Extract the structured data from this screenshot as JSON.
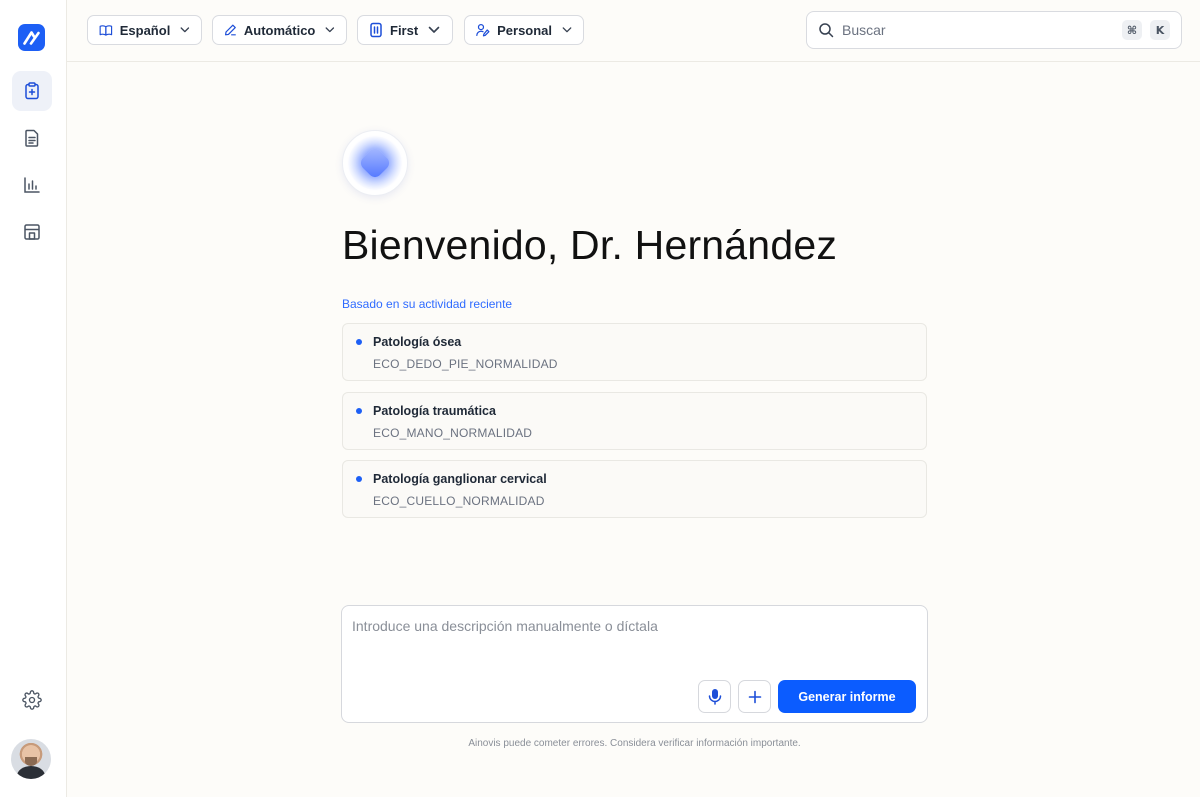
{
  "colors": {
    "accent": "#0b5cff",
    "link": "#2f6bff",
    "background": "#fdfcf9"
  },
  "sidebar": {
    "items": [
      {
        "name": "new-report",
        "icon": "clipboard-plus-icon",
        "active": true
      },
      {
        "name": "documents",
        "icon": "document-icon",
        "active": false
      },
      {
        "name": "statistics",
        "icon": "bar-chart-icon",
        "active": false
      },
      {
        "name": "templates",
        "icon": "layout-icon",
        "active": false
      }
    ],
    "settings_icon": "gear-icon"
  },
  "toolbar": {
    "language_label": "Español",
    "mode_label": "Automático",
    "template_label": "First",
    "profile_label": "Personal"
  },
  "search": {
    "placeholder": "Buscar",
    "shortcut_cmd": "⌘",
    "shortcut_key": "K"
  },
  "main": {
    "welcome": "Bienvenido, Dr. Hernández",
    "recent_label": "Basado en su actividad reciente",
    "recent": [
      {
        "title": "Patología ósea",
        "code": "ECO_DEDO_PIE_NORMALIDAD"
      },
      {
        "title": "Patología traumática",
        "code": "ECO_MANO_NORMALIDAD"
      },
      {
        "title": "Patología ganglionar cervical",
        "code": "ECO_CUELLO_NORMALIDAD"
      }
    ]
  },
  "composer": {
    "placeholder": "Introduce una descripción manualmente o díctala",
    "generate_label": "Generar informe",
    "disclaimer": "Ainovis puede cometer errores. Considera verificar información importante."
  }
}
